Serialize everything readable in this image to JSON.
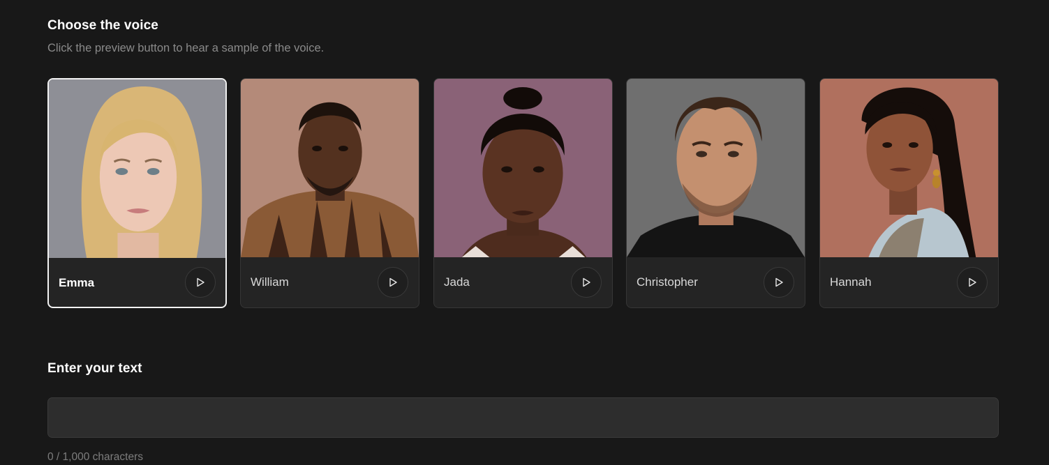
{
  "voice_section": {
    "title": "Choose the voice",
    "subtitle": "Click the preview button to hear a sample of the voice."
  },
  "voices": [
    {
      "name": "Emma",
      "selected": true,
      "bg": "#8e8f96"
    },
    {
      "name": "William",
      "selected": false,
      "bg": "#b48a79"
    },
    {
      "name": "Jada",
      "selected": false,
      "bg": "#8a6277"
    },
    {
      "name": "Christopher",
      "selected": false,
      "bg": "#6f6f6f"
    },
    {
      "name": "Hannah",
      "selected": false,
      "bg": "#b0705e"
    }
  ],
  "text_section": {
    "title": "Enter your text",
    "input_value": "",
    "input_placeholder": "",
    "counter": "0 / 1,000 characters"
  },
  "icons": {
    "play": "play-icon"
  }
}
